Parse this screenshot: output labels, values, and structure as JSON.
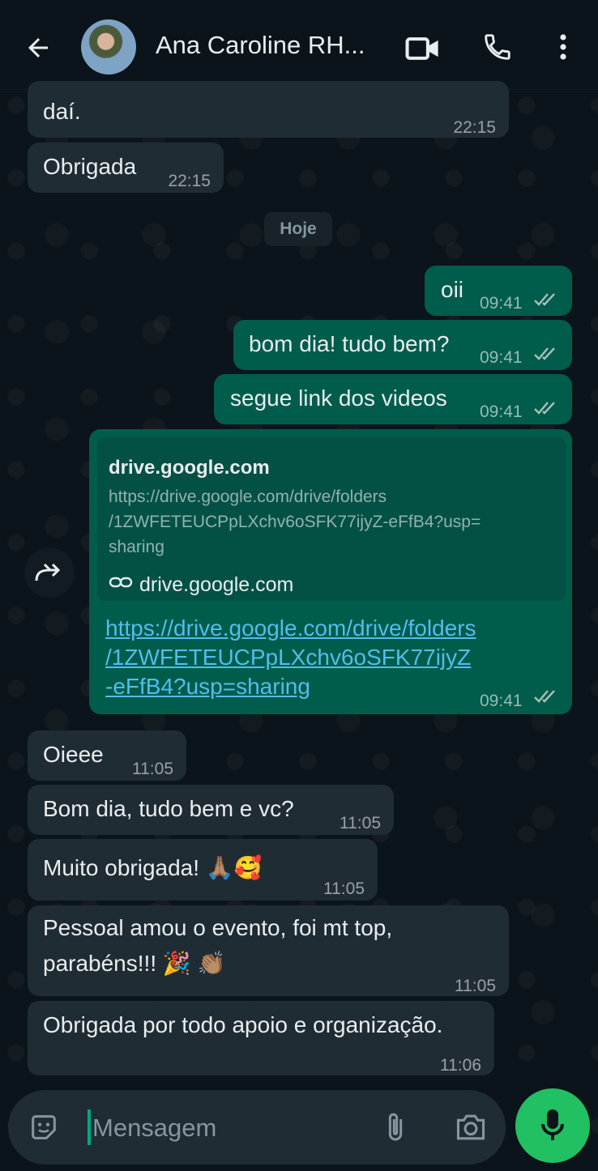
{
  "header": {
    "contact_name": "Ana Caroline RH...",
    "icons": [
      "back-arrow-icon",
      "avatar",
      "video-call-icon",
      "phone-icon",
      "more-vert-icon"
    ]
  },
  "messages": {
    "m1": {
      "text": "daí.",
      "time": "22:15"
    },
    "m2": {
      "text": "Obrigada",
      "time": "22:15"
    },
    "date_chip": "Hoje",
    "m3": {
      "text": "oii",
      "time": "09:41"
    },
    "m4": {
      "text": "bom dia! tudo bem?",
      "time": "09:41"
    },
    "m5": {
      "text": "segue link dos videos",
      "time": "09:41"
    },
    "m6": {
      "preview_title": "drive.google.com",
      "preview_url_line1": "https://drive.google.com/drive/folders",
      "preview_url_line2": "/1ZWFETEUCPpLXchv6oSFK77ijyZ-eFfB4?usp=",
      "preview_url_line3": "sharing",
      "preview_domain": "drive.google.com",
      "link_line1": "https://drive.google.com/drive/folders",
      "link_line2": "/1ZWFETEUCPpLXchv6oSFK77ijyZ",
      "link_line3": "-eFfB4?usp=sharing",
      "time": "09:41"
    },
    "m7": {
      "text": "Oieee",
      "time": "11:05"
    },
    "m8": {
      "text": "Bom dia, tudo bem e vc?",
      "time": "11:05"
    },
    "m9": {
      "text": "Muito obrigada! 🙏🏽🥰",
      "time": "11:05"
    },
    "m10": {
      "line1": "Pessoal amou o evento, foi mt top,",
      "line2": "parabéns!!! 🎉 👏🏽",
      "time": "11:05"
    },
    "m11": {
      "text": "Obrigada por todo apoio e organização.",
      "time": "11:06"
    }
  },
  "composer": {
    "placeholder": "Mensagem",
    "icons": [
      "emoji-icon",
      "attach-icon",
      "camera-icon",
      "mic-icon"
    ]
  },
  "colors": {
    "background": "#0b141a",
    "incoming": "#202c33",
    "outgoing": "#005c4b",
    "link": "#53bdeb",
    "accent": "#21c063"
  }
}
